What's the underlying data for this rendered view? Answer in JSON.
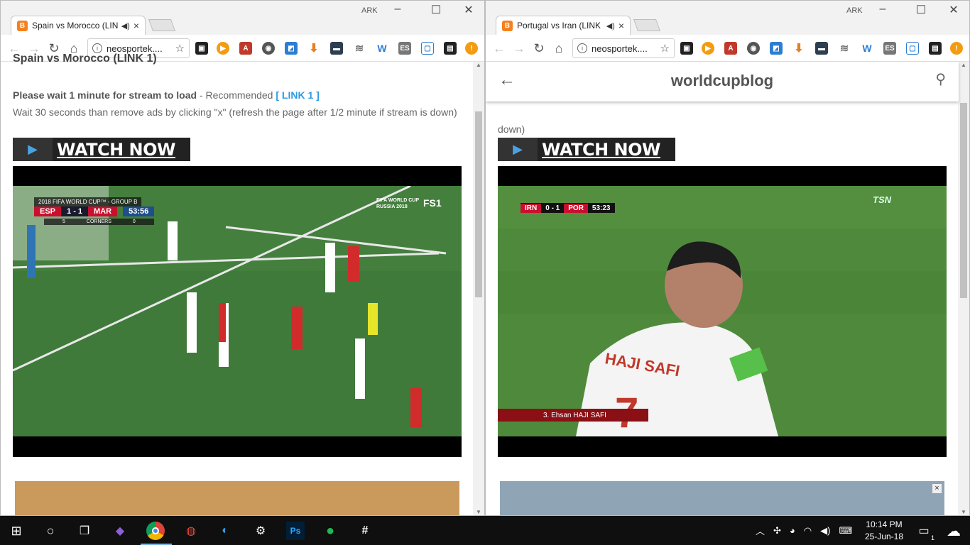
{
  "left_window": {
    "user": "ARK",
    "tab_title": "Spain vs Morocco (LIN",
    "tab_favicon": "B",
    "url": "neosportek....",
    "partial_heading": "Spain vs Morocco (LINK 1)",
    "wait_bold": "Please wait 1 minute for stream to load",
    "wait_rest": " - Recommended ",
    "link_text": "[ LINK 1 ]",
    "info_line": "Wait 30 seconds than remove ads by clicking \"x\" (refresh the page after 1/2 minute if stream is down)",
    "watch_now": "WATCH NOW",
    "video": {
      "bug_top": "2018 FIFA WORLD CUP™ - GROUP B",
      "team1": "ESP",
      "score": "1 - 1",
      "team2": "MAR",
      "time": "53:56",
      "corners_left": "5",
      "corners_label": "CORNERS",
      "corners_right": "0",
      "broadcaster": "FS1",
      "brand": "FIFA WORLD CUP RUSSIA 2018"
    }
  },
  "right_window": {
    "user": "ARK",
    "tab_title": "Portugal vs Iran (LINK",
    "tab_favicon": "B",
    "url": "neosportek....",
    "blog_title": "worldcupblog",
    "info_line_tail": "down)",
    "watch_now": "WATCH NOW",
    "video": {
      "team1": "IRN",
      "score": "0 - 1",
      "team2": "POR",
      "time": "53:23",
      "broadcaster": "TSN",
      "player_caption": "3. Ehsan HAJI SAFI",
      "shirt_name": "HAJI SAFI",
      "shirt_number": "7"
    },
    "ad_close": "×"
  },
  "taskbar": {
    "clock_time": "10:14 PM",
    "clock_date": "25-Jun-18",
    "notification_count": "1"
  },
  "colors": {
    "link": "#2e9ae0",
    "taskbar": "#0f0f0f",
    "pitch": "#3f7a3a",
    "favicon": "#f4811e"
  }
}
